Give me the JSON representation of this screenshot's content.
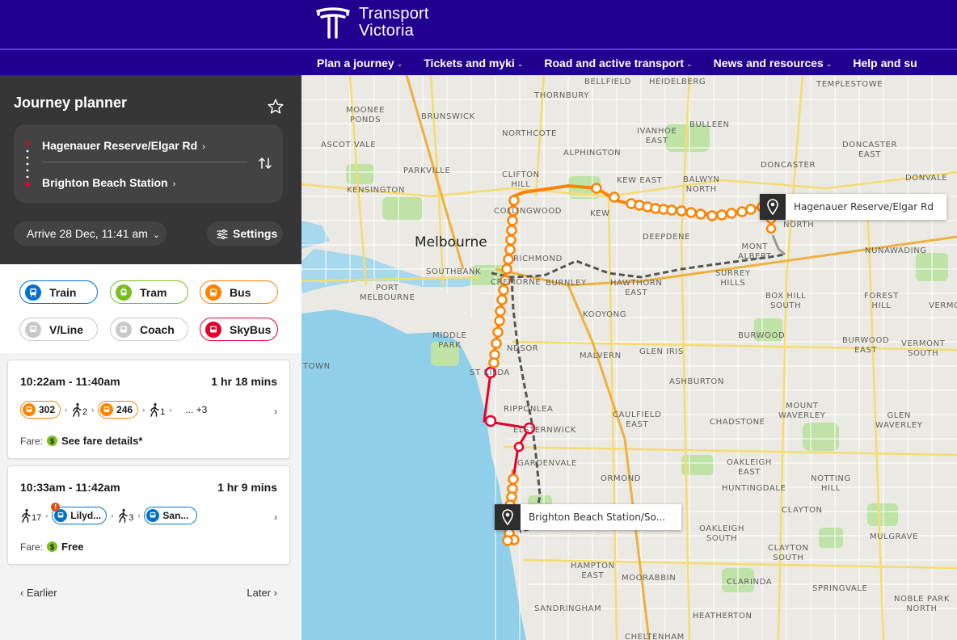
{
  "brand": {
    "line1": "Transport",
    "line2": "Victoria"
  },
  "nav": [
    {
      "label": "Plan a journey"
    },
    {
      "label": "Tickets and myki"
    },
    {
      "label": "Road and active transport"
    },
    {
      "label": "News and resources"
    },
    {
      "label": "Help and su"
    }
  ],
  "planner": {
    "title": "Journey planner",
    "from": "Hagenauer Reserve/Elgar Rd",
    "to": "Brighton Beach Station",
    "arrive": "Arrive 28 Dec, 11:41 am",
    "settings": "Settings"
  },
  "modes": [
    {
      "label": "Train",
      "color": "#0072ce"
    },
    {
      "label": "Tram",
      "color": "#78be20"
    },
    {
      "label": "Bus",
      "color": "#ff8200"
    },
    {
      "label": "V/Line",
      "color": "#b0b0b0"
    },
    {
      "label": "Coach",
      "color": "#b0b0b0"
    },
    {
      "label": "SkyBus",
      "color": "#e4002b"
    }
  ],
  "results": [
    {
      "time": "10:22am - 11:40am",
      "duration": "1 hr 18 mins",
      "legs": {
        "bus1": "302",
        "walk1": "2",
        "bus2": "246",
        "walk2": "1",
        "more": "... +3"
      },
      "fare_label": "Fare:",
      "fare_value": "See fare details*"
    },
    {
      "time": "10:33am - 11:42am",
      "duration": "1 hr 9 mins",
      "legs": {
        "walk1": "17",
        "train1": "Lilyd...",
        "walk2": "3",
        "train2": "San..."
      },
      "alert": "!",
      "fare_label": "Fare:",
      "fare_value": "Free"
    }
  ],
  "pager": {
    "earlier": "Earlier",
    "later": "Later"
  },
  "map": {
    "city": "Melbourne",
    "origin_pin": "Hagenauer Reserve/Elgar Rd",
    "dest_pin": "Brighton Beach Station/So...",
    "labels": {
      "bellfield": "BELLFIELD",
      "heidelberg": "HEIDELBERG",
      "templestowe": "TEMPLESTOWE",
      "thornbury": "THORNBURY",
      "moonee_ponds": "MOONEE\nPONDS",
      "brunswick": "BRUNSWICK",
      "northcote": "NORTHCOTE",
      "ivanhoe_east": "IVANHOE\nEAST",
      "bulleen": "BULLEEN",
      "ascot_vale": "ASCOT VALE",
      "alphington": "ALPHINGTON",
      "doncaster_east": "DONCASTER\nEAST",
      "parkville": "PARKVILLE",
      "clifton_hill": "CLIFTON\nHILL",
      "kew_east": "KEW EAST",
      "balwyn_north": "BALWYN\nNORTH",
      "doncaster": "DONCASTER",
      "donvale": "DONVALE",
      "kensington": "KENSINGTON",
      "collingwood": "COLLINGWOOD",
      "kew": "KEW",
      "north": "NORTH",
      "deepdene": "DEEPDENE",
      "mont_albert": "MONT\nALBERT",
      "nunawading": "NUNAWADING",
      "richmond": "RICHMOND",
      "southbank": "SOUTHBANK",
      "cremorne": "CREMORNE",
      "burnley": "BURNLEY",
      "hawthorn_east": "HAWTHORN\nEAST",
      "surrey_hills": "SURREY\nHILLS",
      "box_hill_south": "BOX HILL\nSOUTH",
      "forest_hill": "FOREST\nHILL",
      "vermont": "VERMON",
      "port_melbourne": "PORT\nMELBOURNE",
      "kooyong": "KOOYONG",
      "burwood": "BURWOOD",
      "middle_park": "MIDDLE\nPARK",
      "windsor": "NDSOR",
      "malvern": "MALVERN",
      "glen_iris": "GLEN IRIS",
      "burwood_east": "BURWOOD\nEAST",
      "vermont_south": "VERMONT\nSOUTH",
      "town": "TOWN",
      "st_kilda": "ST KILDA",
      "ashburton": "ASHBURTON",
      "ripponlea": "RIPPONLEA",
      "elsternwick": "ELSTERNWICK",
      "caulfield_east": "CAULFIELD\nEAST",
      "chadstone": "CHADSTONE",
      "mount_waverley": "MOUNT\nWAVERLEY",
      "glen_waverley": "GLEN\nWAVERLEY",
      "gardenvale": "GARDENVALE",
      "ormond": "ORMOND",
      "oakleigh_east": "OAKLEIGH\nEAST",
      "huntingdale": "HUNTINGDALE",
      "notting_hill": "NOTTING\nHILL",
      "clayton": "CLAYTON",
      "oakleigh_south": "OAKLEIGH\nSOUTH",
      "mulgrave": "MULGRAVE",
      "clayton_south": "CLAYTON\nSOUTH",
      "hampton_east": "HAMPTON\nEAST",
      "moorabbin": "MOORABBIN",
      "clarinda": "CLARINDA",
      "springvale": "SPRINGVALE",
      "noble_park_north": "NOBLE PARK\nNORTH",
      "sandringham": "SANDRINGHAM",
      "heatherton": "HEATHERTON",
      "cheltenham": "CHELTENHAM"
    }
  },
  "colors": {
    "brand": "#22008f",
    "bus": "#ff8200",
    "train": "#0072ce",
    "route_red": "#e4002b"
  }
}
